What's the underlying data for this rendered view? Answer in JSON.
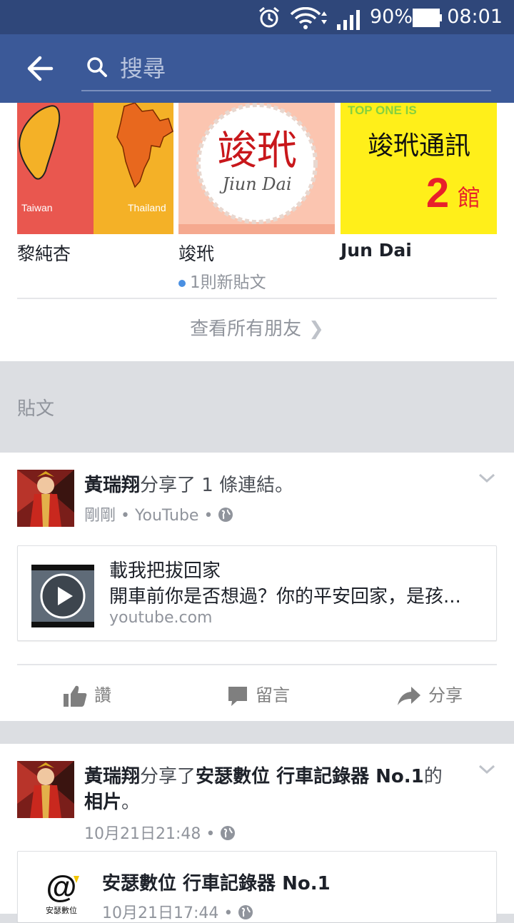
{
  "status_bar": {
    "battery": "90%",
    "time": "08:01"
  },
  "header": {
    "search_placeholder": "搜尋"
  },
  "friends": [
    {
      "name": "黎純杏",
      "photo_labels": [
        "Taiwan",
        "Thailand"
      ]
    },
    {
      "name": "竣玳",
      "new_posts": "1則新貼文",
      "photo_title": "竣玳",
      "photo_subtitle": "Jiun Dai"
    },
    {
      "name": "Jun Dai",
      "photo_top": "TOP ONE IS",
      "photo_title": "竣玳通訊",
      "photo_num": "2",
      "photo_suffix": "館"
    }
  ],
  "see_all": "查看所有朋友",
  "section_label": "貼文",
  "posts": [
    {
      "author": "黃瑞翔",
      "action": "分享了 1 條連結。",
      "time": "剛剛",
      "source": "YouTube",
      "link": {
        "title": "載我把拔回家",
        "desc": "開車前你是否想過？你的平安回家，是孩...",
        "domain": "youtube.com"
      },
      "actions": {
        "like": "讚",
        "comment": "留言",
        "share": "分享"
      }
    },
    {
      "author": "黃瑞翔",
      "action_prefix": "分享了",
      "page": "安瑟數位 行車記錄器 No.1",
      "action_mid": "的",
      "photo_word": "相片",
      "action_end": "。",
      "time": "10月21日21:48",
      "shared": {
        "page": "安瑟數位 行車記錄器 No.1",
        "time": "10月21日17:44",
        "logo_text": "安瑟數位"
      }
    }
  ],
  "colors": {
    "header": "#3b5998",
    "status": "#2f477a",
    "muted": "#90949c",
    "dot": "#4a90e2"
  }
}
